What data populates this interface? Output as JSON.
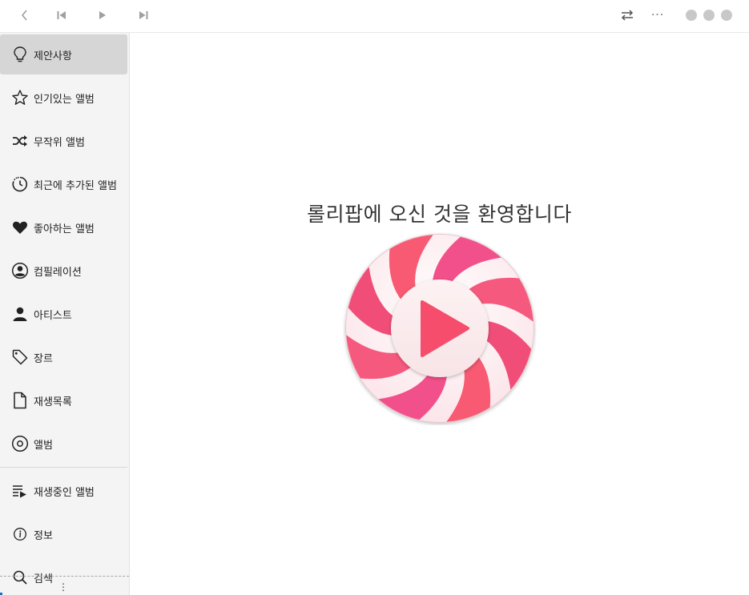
{
  "toolbar": {
    "back_icon": "chevron-left-icon",
    "prev_icon": "skip-previous-icon",
    "play_icon": "play-icon",
    "next_icon": "skip-next-icon",
    "repeat_icon": "repeat-icon",
    "more_label": "···"
  },
  "sidebar": {
    "items": [
      {
        "label": "제안사항",
        "icon": "lightbulb-icon"
      },
      {
        "label": "인기있는 앨범",
        "icon": "star-icon"
      },
      {
        "label": "무작위 앨범",
        "icon": "shuffle-icon"
      },
      {
        "label": "최근에 추가된 앨범",
        "icon": "recent-icon"
      },
      {
        "label": "좋아하는 앨범",
        "icon": "heart-icon"
      },
      {
        "label": "컴필레이션",
        "icon": "user-circle-icon"
      },
      {
        "label": "아티스트",
        "icon": "person-icon"
      },
      {
        "label": "장르",
        "icon": "tag-icon"
      },
      {
        "label": "재생목록",
        "icon": "document-icon"
      },
      {
        "label": "앨범",
        "icon": "disc-icon"
      }
    ],
    "bottom_items": [
      {
        "label": "재생중인 앨범",
        "icon": "queue-playing-icon"
      },
      {
        "label": "정보",
        "icon": "info-icon"
      },
      {
        "label": "검색",
        "icon": "search-icon"
      }
    ],
    "handle_label": "⋮"
  },
  "main": {
    "welcome_text": "롤리팝에 오신 것을 환영합니다",
    "logo_icon": "lollypop-logo-icon"
  },
  "colors": {
    "accent": "#f54d6b",
    "sidebar_bg": "#f4f4f4",
    "active_item_bg": "#d6d6d6"
  }
}
